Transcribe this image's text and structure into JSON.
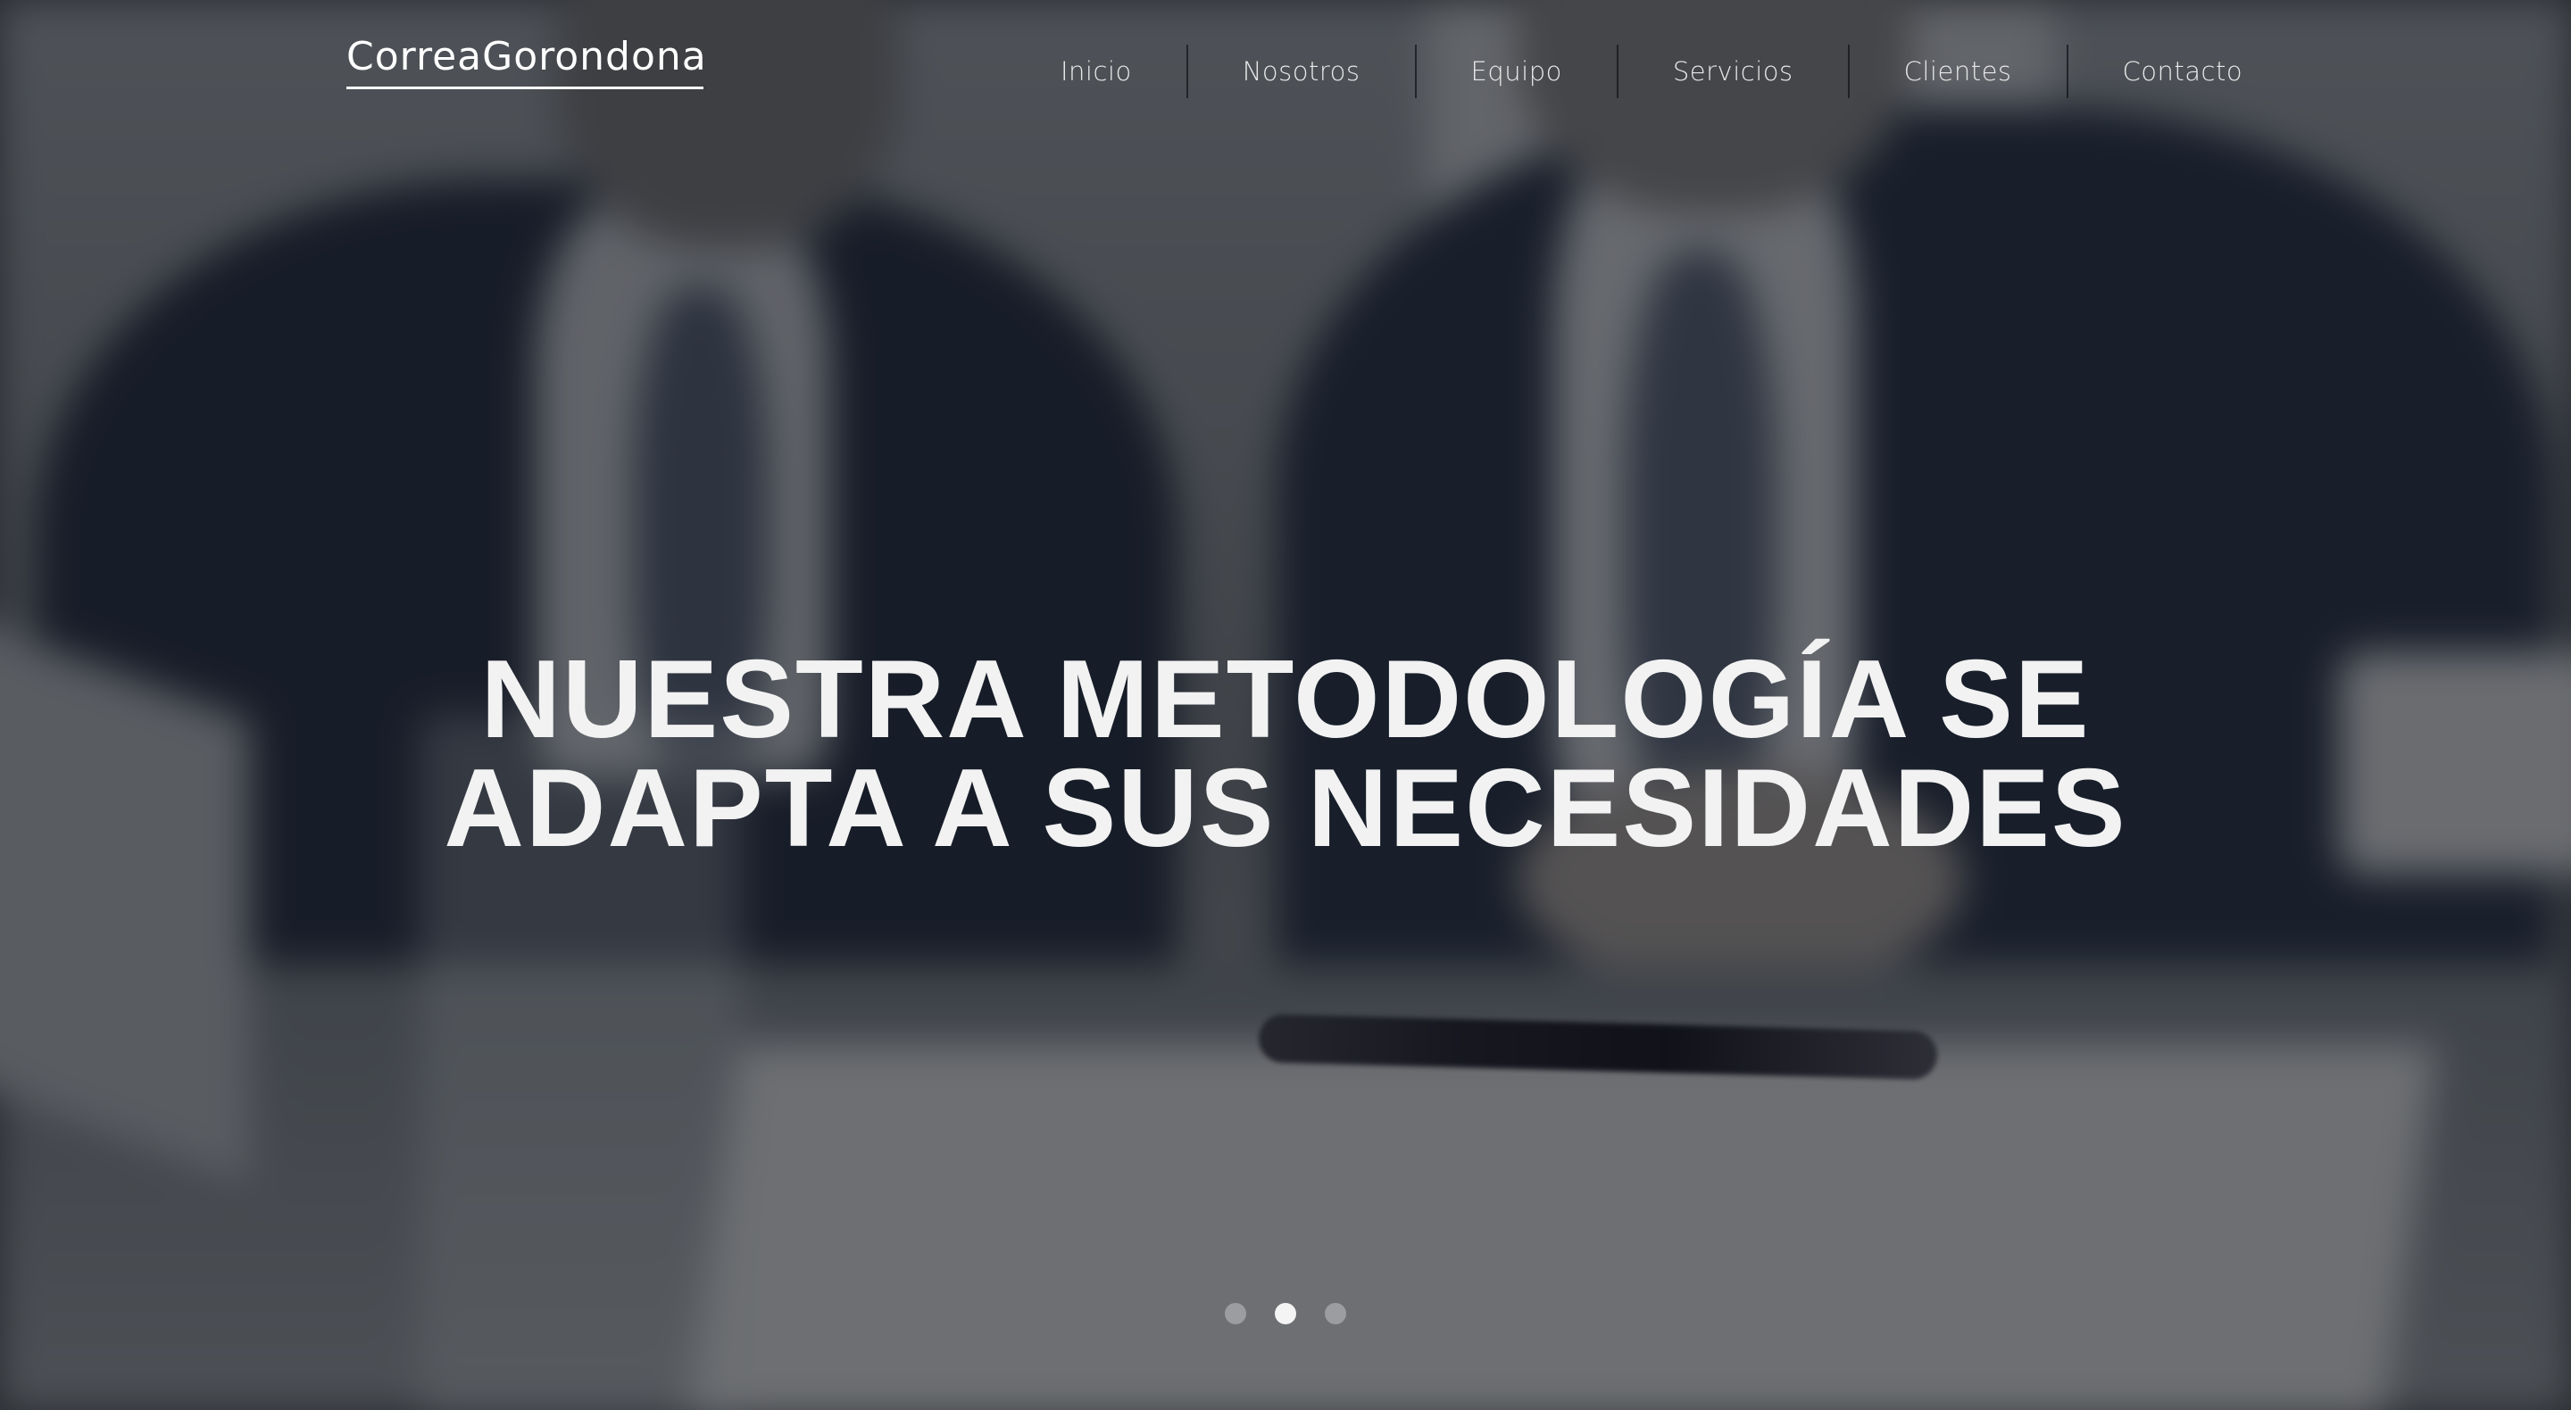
{
  "header": {
    "logo_text": "CorreaGorondona",
    "nav": [
      {
        "label": "Inicio"
      },
      {
        "label": "Nosotros"
      },
      {
        "label": "Equipo"
      },
      {
        "label": "Servicios"
      },
      {
        "label": "Clientes"
      },
      {
        "label": "Contacto"
      }
    ]
  },
  "hero": {
    "headline_line1": "NUESTRA METODOLOGÍA SE",
    "headline_line2": "ADAPTA A SUS NECESIDADES",
    "slider": {
      "slide_count": 3,
      "active_index": 1
    }
  },
  "colors": {
    "overlay": "#14161a",
    "text": "#f2f2f2",
    "dot_active": "#f4f4f4",
    "dot_inactive": "#9b9da0"
  }
}
